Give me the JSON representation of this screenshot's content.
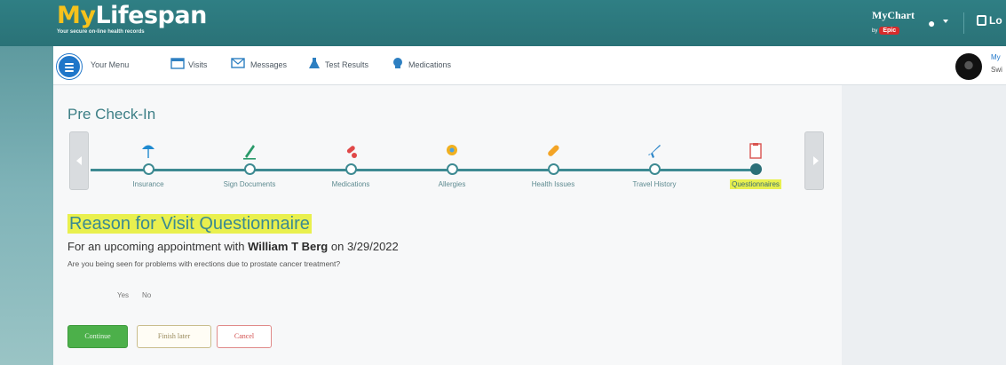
{
  "header": {
    "logo_my": "My",
    "logo_rest": "Lifespan",
    "tagline": "Your secure on-line health records",
    "mychart": "MyChart",
    "mychart_by": "by",
    "epic": "Epic",
    "logout": "Lo"
  },
  "menu": {
    "your_menu": "Your Menu",
    "items": [
      {
        "label": "Visits",
        "icon": "calendar-icon"
      },
      {
        "label": "Messages",
        "icon": "envelope-icon"
      },
      {
        "label": "Test Results",
        "icon": "flask-icon"
      },
      {
        "label": "Medications",
        "icon": "pill-icon"
      }
    ],
    "user_line1": "My",
    "user_line2": "Swi"
  },
  "page": {
    "title": "Pre Check-In",
    "steps": [
      {
        "label": "Insurance",
        "icon": "umbrella-icon",
        "color": "#1f8ad0"
      },
      {
        "label": "Sign Documents",
        "icon": "pen-icon",
        "color": "#2a9a6a"
      },
      {
        "label": "Medications",
        "icon": "pills-icon",
        "color": "#e04848"
      },
      {
        "label": "Allergies",
        "icon": "flower-icon",
        "color": "#f0b020"
      },
      {
        "label": "Health Issues",
        "icon": "bandage-icon",
        "color": "#f3a426"
      },
      {
        "label": "Travel History",
        "icon": "airplane-icon",
        "color": "#2d86c9"
      },
      {
        "label": "Questionnaires",
        "icon": "clipboard-icon",
        "color": "#d9534f",
        "active": true
      }
    ],
    "questionnaire_title": "Reason for Visit Questionnaire",
    "appt_prefix": "For an upcoming appointment with ",
    "provider": "William T Berg",
    "appt_on": " on ",
    "appt_date": "3/29/2022",
    "question": "Are you being seen for problems with erections due to prostate cancer treatment?",
    "options": [
      "Yes",
      "No"
    ],
    "buttons": {
      "continue": "Continue",
      "finish_later": "Finish later",
      "cancel": "Cancel"
    }
  }
}
